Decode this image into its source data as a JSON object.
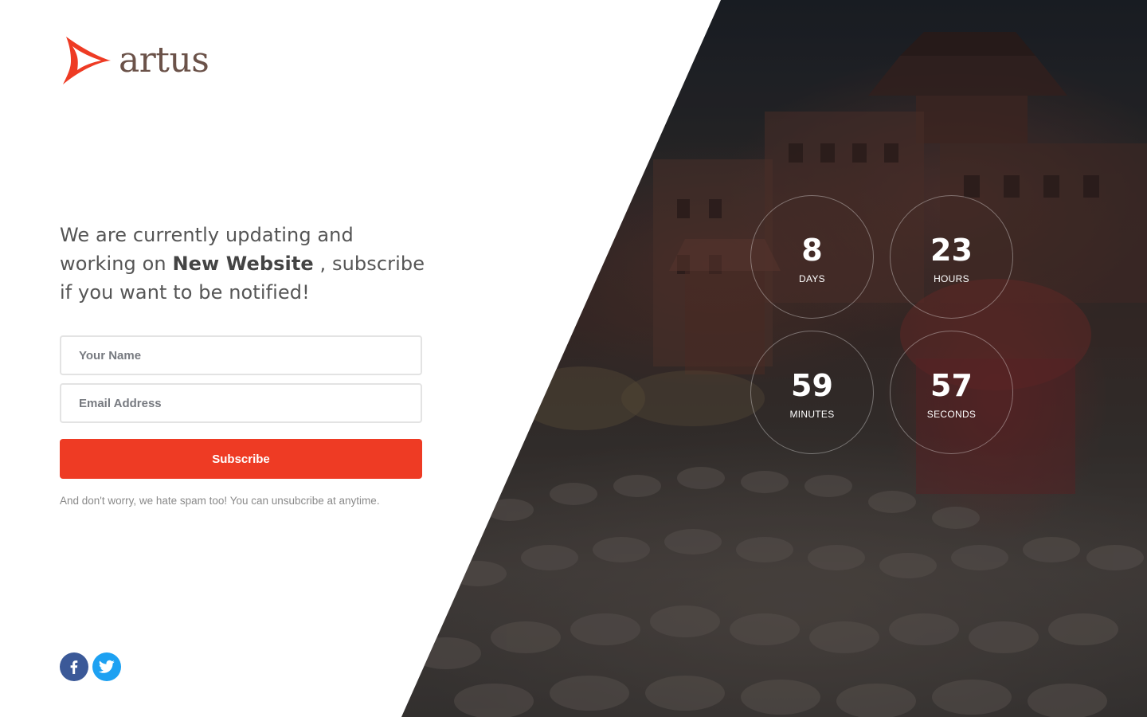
{
  "brand": {
    "name": "artus",
    "accent_color": "#ee3b24",
    "text_color": "#6b5249",
    "logo_icon": "triangle-swoosh-logo-icon"
  },
  "headline": {
    "before": "We are currently updating and working on",
    "highlight": "New Website",
    "after": ", subscribe if you want to be notified!"
  },
  "form": {
    "name_placeholder": "Your Name",
    "name_value": "",
    "email_placeholder": "Email Address",
    "email_value": "",
    "subscribe_label": "Subscribe",
    "subscribe_color": "#ee3b24",
    "note": "And don't worry, we hate spam too! You can unsubcribe at anytime."
  },
  "social": {
    "facebook_icon": "facebook-icon",
    "facebook_color": "#3b5998",
    "twitter_icon": "twitter-icon",
    "twitter_color": "#1da1f2"
  },
  "countdown": {
    "days": {
      "value": "8",
      "label": "DAYS"
    },
    "hours": {
      "value": "23",
      "label": "HOURS"
    },
    "minutes": {
      "value": "59",
      "label": "MINUTES"
    },
    "seconds": {
      "value": "57",
      "label": "SECONDS"
    }
  }
}
